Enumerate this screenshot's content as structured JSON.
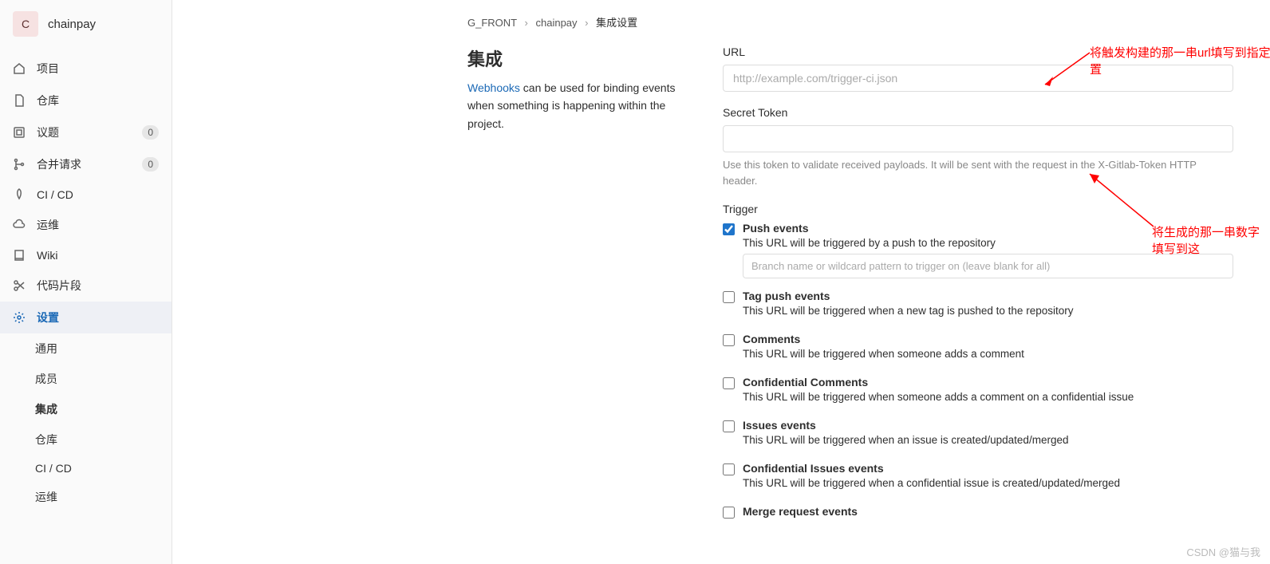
{
  "project": {
    "avatar_letter": "C",
    "name": "chainpay"
  },
  "sidebar": {
    "items": [
      {
        "label": "项目",
        "icon": "home",
        "badge": null
      },
      {
        "label": "仓库",
        "icon": "file",
        "badge": null
      },
      {
        "label": "议题",
        "icon": "issues",
        "badge": "0"
      },
      {
        "label": "合并请求",
        "icon": "merge",
        "badge": "0"
      },
      {
        "label": "CI / CD",
        "icon": "rocket",
        "badge": null
      },
      {
        "label": "运维",
        "icon": "cloud",
        "badge": null
      },
      {
        "label": "Wiki",
        "icon": "book",
        "badge": null
      },
      {
        "label": "代码片段",
        "icon": "scissors",
        "badge": null
      },
      {
        "label": "设置",
        "icon": "gear",
        "badge": null
      }
    ],
    "sub_items": [
      "通用",
      "成员",
      "集成",
      "仓库",
      "CI / CD",
      "运维"
    ]
  },
  "breadcrumb": {
    "root": "G_FRONT",
    "project": "chainpay",
    "current": "集成设置"
  },
  "page": {
    "title": "集成",
    "desc_link": "Webhooks",
    "desc_rest": " can be used for binding events when something is happening within the project."
  },
  "form": {
    "url_label": "URL",
    "url_placeholder": "http://example.com/trigger-ci.json",
    "token_label": "Secret Token",
    "token_help": "Use this token to validate received payloads. It will be sent with the request in the X-Gitlab-Token HTTP header.",
    "trigger_label": "Trigger",
    "branch_placeholder": "Branch name or wildcard pattern to trigger on (leave blank for all)",
    "triggers": [
      {
        "title": "Push events",
        "desc": "This URL will be triggered by a push to the repository",
        "checked": true,
        "has_input": true
      },
      {
        "title": "Tag push events",
        "desc": "This URL will be triggered when a new tag is pushed to the repository",
        "checked": false
      },
      {
        "title": "Comments",
        "desc": "This URL will be triggered when someone adds a comment",
        "checked": false
      },
      {
        "title": "Confidential Comments",
        "desc": "This URL will be triggered when someone adds a comment on a confidential issue",
        "checked": false
      },
      {
        "title": "Issues events",
        "desc": "This URL will be triggered when an issue is created/updated/merged",
        "checked": false
      },
      {
        "title": "Confidential Issues events",
        "desc": "This URL will be triggered when a confidential issue is created/updated/merged",
        "checked": false
      },
      {
        "title": "Merge request events",
        "desc": "",
        "checked": false
      }
    ]
  },
  "annotations": {
    "a1": "将触发构建的那一串url填写到指定项目设置集成中的这个位置",
    "a2": "将生成的那一串数字填写到这"
  },
  "watermark": "CSDN @猫与我"
}
